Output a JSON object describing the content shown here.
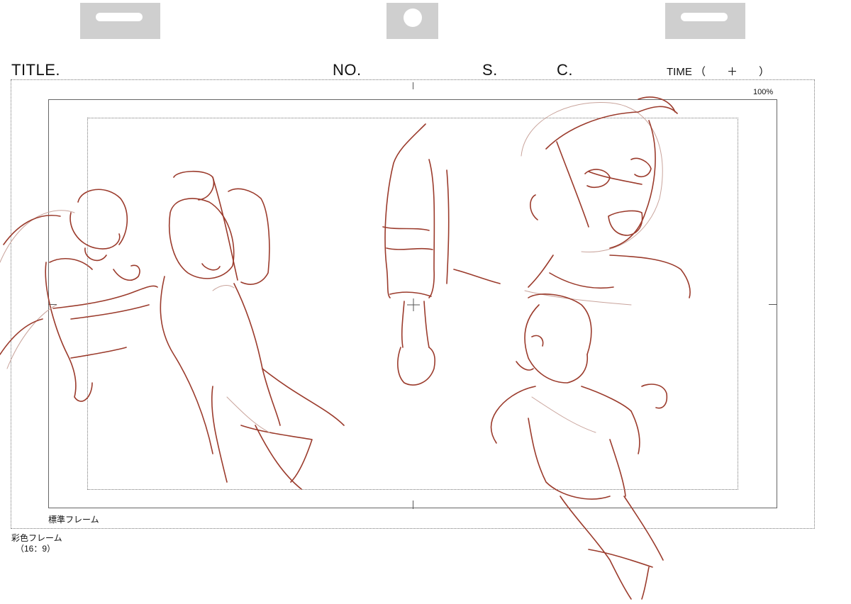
{
  "header": {
    "title_label": "TITLE.",
    "no_label": "NO.",
    "s_label": "S.",
    "c_label": "C.",
    "time_label": "TIME （　　＋　　）"
  },
  "frame": {
    "percent_label": "100%",
    "standard_frame_label": "標準フレーム",
    "color_frame_label": "彩色フレーム",
    "color_frame_ratio": "（16：9）"
  },
  "colors": {
    "sketch_line": "#9b3b2c",
    "peg_tab": "#cfcfcf"
  }
}
